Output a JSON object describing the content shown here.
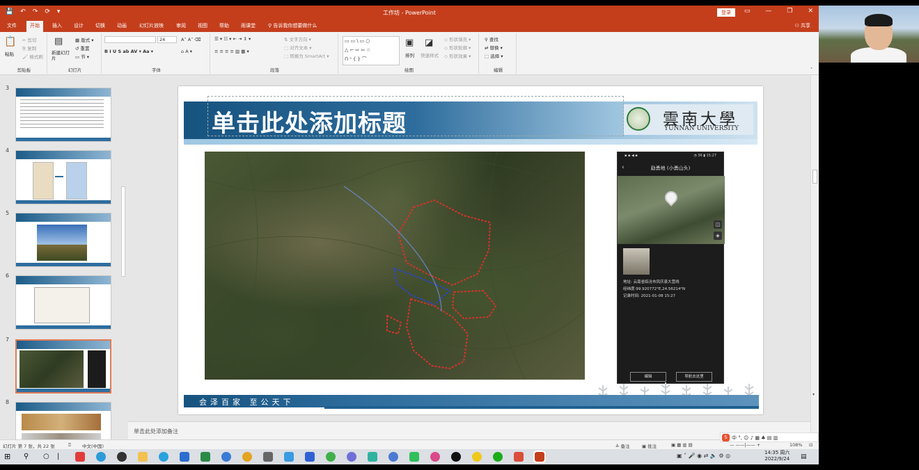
{
  "app": {
    "window_title": "工作坊  -  PowerPoint",
    "login_label": "登录",
    "share_label": "共享",
    "quick_access": [
      "💾",
      "↶",
      "↷",
      "⟳",
      "▾"
    ]
  },
  "tabs": [
    "文件",
    "开始",
    "插入",
    "设计",
    "切换",
    "动画",
    "幻灯片放映",
    "审阅",
    "视图",
    "帮助",
    "雨课堂"
  ],
  "active_tab": "开始",
  "tell_me": "告诉我你想要做什么",
  "ribbon": {
    "clipboard": {
      "paste": "粘贴",
      "cut": "剪切",
      "copy": "复制",
      "format_painter": "格式刷",
      "label": "剪贴板"
    },
    "slides": {
      "new_slide": "新建幻灯片",
      "layout": "版式",
      "reset": "重置",
      "section": "节",
      "label": "幻灯片"
    },
    "font": {
      "size": "24",
      "label": "字体"
    },
    "paragraph": {
      "text_direction": "文字方向",
      "align_text": "对齐文本",
      "smartart": "转换为 SmartArt",
      "label": "段落"
    },
    "drawing": {
      "arrange": "排列",
      "quick_styles": "快速样式",
      "shape_fill": "形状填充",
      "shape_outline": "形状轮廓",
      "shape_effects": "形状效果",
      "label": "绘图"
    },
    "editing": {
      "find": "查找",
      "replace": "替换",
      "select": "选择",
      "label": "编辑"
    }
  },
  "thumbnails": [
    {
      "num": "3"
    },
    {
      "num": "4"
    },
    {
      "num": "5"
    },
    {
      "num": "6"
    },
    {
      "num": "7"
    },
    {
      "num": "8"
    }
  ],
  "slide": {
    "title": "单击此处添加标题",
    "logo_cn": "雲南大學",
    "logo_en": "YUNNAN UNIVERSITY",
    "motto": "会泽百家 至公天下",
    "phone": {
      "status_left": "▪ ▪ ◀ ▪",
      "status_right": "◔ 36 ▮ 15:27",
      "title": "勐勇地 (小勇山头)",
      "addr": "地址: 云南省临沧市凤庆县大营线",
      "coords": "经纬度:99.920772°E,24.56214°N",
      "time": "记录时间: 2021-01-08  15:27",
      "btn_edit": "编辑",
      "btn_nav": "导航去这里"
    }
  },
  "notes_placeholder": "单击此处添加备注",
  "status": {
    "slide_count": "幻灯片 第 7 张，共 22 张",
    "language": "中文(中国)",
    "notes": "备注",
    "comments": "批注",
    "zoom": "108%"
  },
  "ime": "中 °, ☺ ♪ ▦ ♣ ▤ ▥",
  "clock": {
    "time": "14:35 周六",
    "date": "2022/9/24"
  },
  "colors": {
    "accent": "#c43e1c",
    "slide_blue": "#1f5f8f"
  }
}
